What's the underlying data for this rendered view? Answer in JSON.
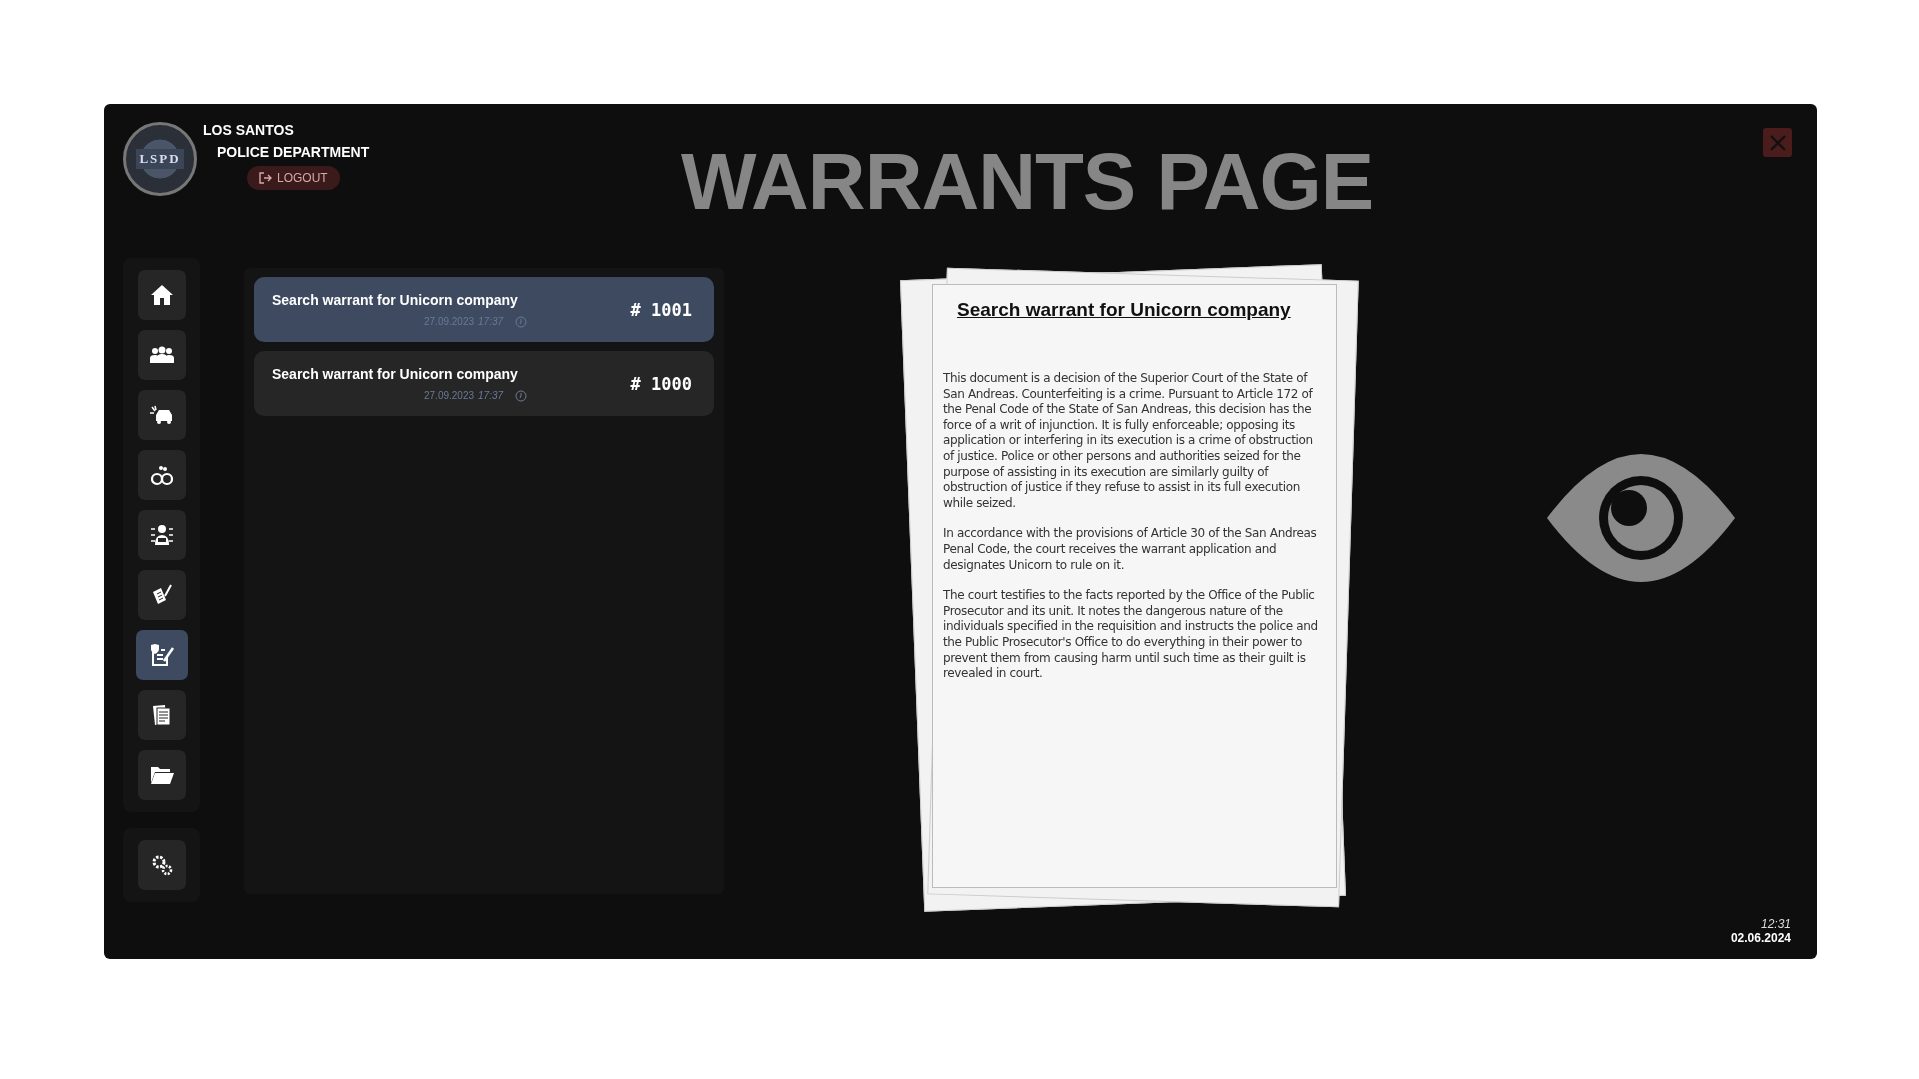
{
  "header": {
    "org_line_1": "LOS SANTOS",
    "org_line_2": "POLICE DEPARTMENT",
    "logo_text": "LSPD",
    "logout": "LOGOUT",
    "title": "WARRANTS PAGE"
  },
  "sidebar": {
    "items": [
      {
        "kind": "home",
        "selected": false
      },
      {
        "kind": "people",
        "selected": false
      },
      {
        "kind": "car",
        "selected": false
      },
      {
        "kind": "handcuffs",
        "selected": false
      },
      {
        "kind": "mugshot",
        "selected": false
      },
      {
        "kind": "sign",
        "selected": false
      },
      {
        "kind": "warrant",
        "selected": true
      },
      {
        "kind": "papers",
        "selected": false
      },
      {
        "kind": "folder",
        "selected": false
      }
    ],
    "bottom_items": [
      {
        "kind": "settings",
        "selected": false
      }
    ]
  },
  "warrants": [
    {
      "title": "Search warrant for Unicorn company",
      "date": "27.09.2023",
      "time": "17:37",
      "number": "# 1001",
      "selected": true
    },
    {
      "title": "Search warrant for Unicorn company",
      "date": "27.09.2023",
      "time": "17:37",
      "number": "# 1000",
      "selected": false
    }
  ],
  "document": {
    "title": "Search warrant for Unicorn company",
    "paragraphs": [
      "This document is a decision of the Superior Court of the State of San Andreas. Counterfeiting is a crime. Pursuant to Article 172 of the Penal Code of the State of San Andreas, this decision has the force of a writ of injunction. It is fully enforceable; opposing its application or interfering in its execution is a crime of obstruction of justice. Police or other persons and authorities seized for the purpose of assisting in its execution are similarly guilty of obstruction of justice if they refuse to assist in its full execution while seized.",
      "In accordance with the provisions of Article 30 of the San Andreas Penal Code, the court receives the warrant application and designates Unicorn to rule on it.",
      "The court testifies to the facts reported by the Office of the Public Prosecutor and its unit. It notes the dangerous nature of the individuals specified in the requisition and instructs the police and the Public Prosecutor's Office to do everything in their power to prevent them from causing harm until such time as their guilt is revealed in court."
    ]
  },
  "clock": {
    "time": "12:31",
    "date": "02.06.2024"
  }
}
